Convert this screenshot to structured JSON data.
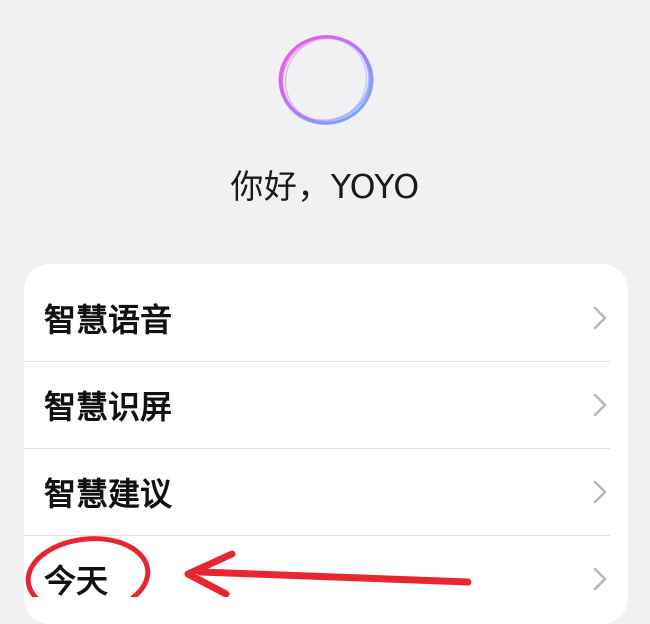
{
  "greeting": {
    "text": "你好，YOYO"
  },
  "menu": {
    "items": [
      {
        "label": "智慧语音"
      },
      {
        "label": "智慧识屏"
      },
      {
        "label": "智慧建议"
      },
      {
        "label": "今天"
      }
    ]
  },
  "icons": {
    "logo": "yoyo-ring-icon",
    "row_chevron": "chevron-right-icon"
  },
  "colors": {
    "background": "#f1f1f3",
    "card": "#ffffff",
    "annotation": "#e8262f",
    "logo_gradient": [
      "#ff4fd8",
      "#b06cff",
      "#4fb8ff"
    ]
  }
}
